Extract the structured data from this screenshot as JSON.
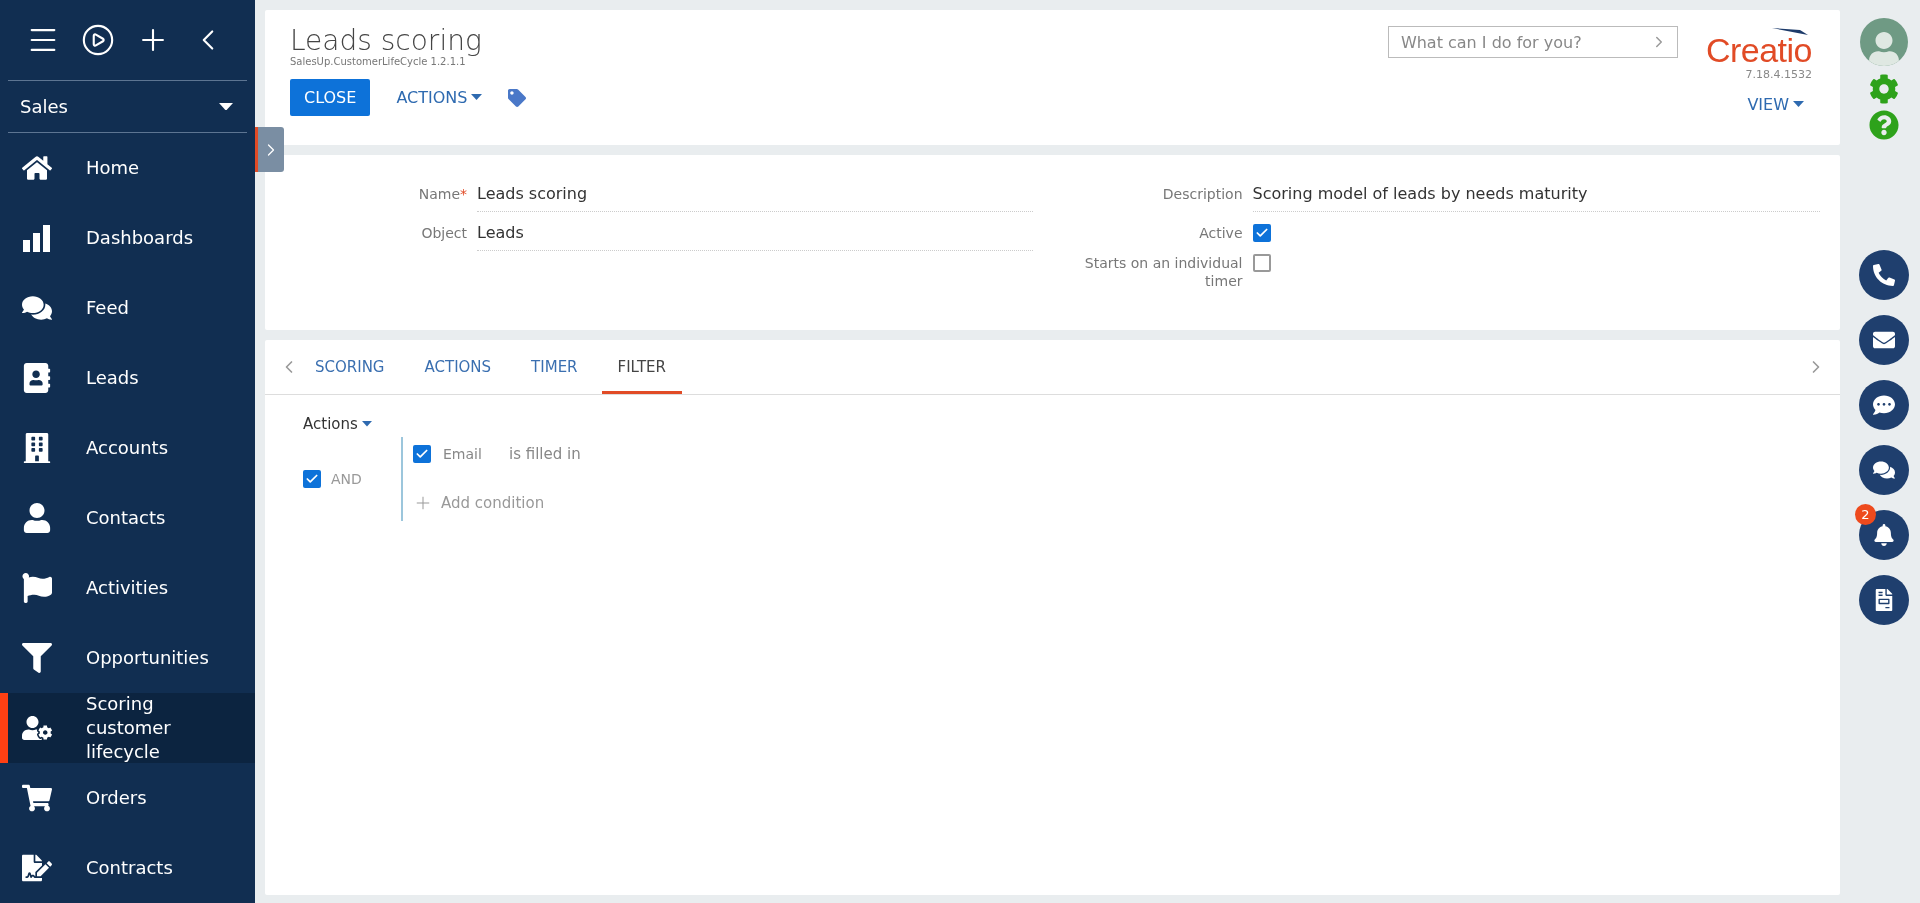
{
  "sidebar": {
    "workplace": "Sales",
    "items": [
      {
        "label": "Home",
        "selected": false
      },
      {
        "label": "Dashboards",
        "selected": false
      },
      {
        "label": "Feed",
        "selected": false
      },
      {
        "label": "Leads",
        "selected": false
      },
      {
        "label": "Accounts",
        "selected": false
      },
      {
        "label": "Contacts",
        "selected": false
      },
      {
        "label": "Activities",
        "selected": false
      },
      {
        "label": "Opportunities",
        "selected": false
      },
      {
        "label": "Scoring customer lifecycle",
        "selected": true
      },
      {
        "label": "Orders",
        "selected": false
      },
      {
        "label": "Contracts",
        "selected": false
      }
    ]
  },
  "header": {
    "title": "Leads scoring",
    "subtitle": "SalesUp.CustomerLifeCycle 1.2.1.1",
    "buttons": [
      {
        "label": "CLOSE",
        "kind": "primary"
      },
      {
        "label": "ACTIONS",
        "kind": "menu"
      }
    ],
    "search": {
      "placeholder": "What can I do for you?"
    },
    "logo": "Creatio",
    "version": "7.18.4.1532",
    "view": "VIEW"
  },
  "form": {
    "left": [
      {
        "label": "Name",
        "required_mark": "*",
        "value": "Leads scoring"
      },
      {
        "label": "Object",
        "value": "Leads"
      }
    ],
    "right": [
      {
        "kind": "text",
        "label": "Description",
        "value": "Scoring model of leads by needs maturity"
      },
      {
        "kind": "checkbox",
        "label": "Active",
        "checked": true
      },
      {
        "kind": "checkbox",
        "label": "Starts on an individual timer",
        "checked": false
      }
    ]
  },
  "tabs": [
    {
      "label": "SCORING",
      "selected": false
    },
    {
      "label": "ACTIONS",
      "selected": false
    },
    {
      "label": "TIMER",
      "selected": false
    },
    {
      "label": "FILTER",
      "selected": true
    }
  ],
  "filter": {
    "actions": "Actions",
    "group": {
      "checked": true,
      "logic": "AND"
    },
    "conditions": [
      {
        "checked": true,
        "column": "Email",
        "operator": "is filled in"
      }
    ],
    "add_condition": "Add condition"
  },
  "notifications": {
    "badge": "2"
  }
}
